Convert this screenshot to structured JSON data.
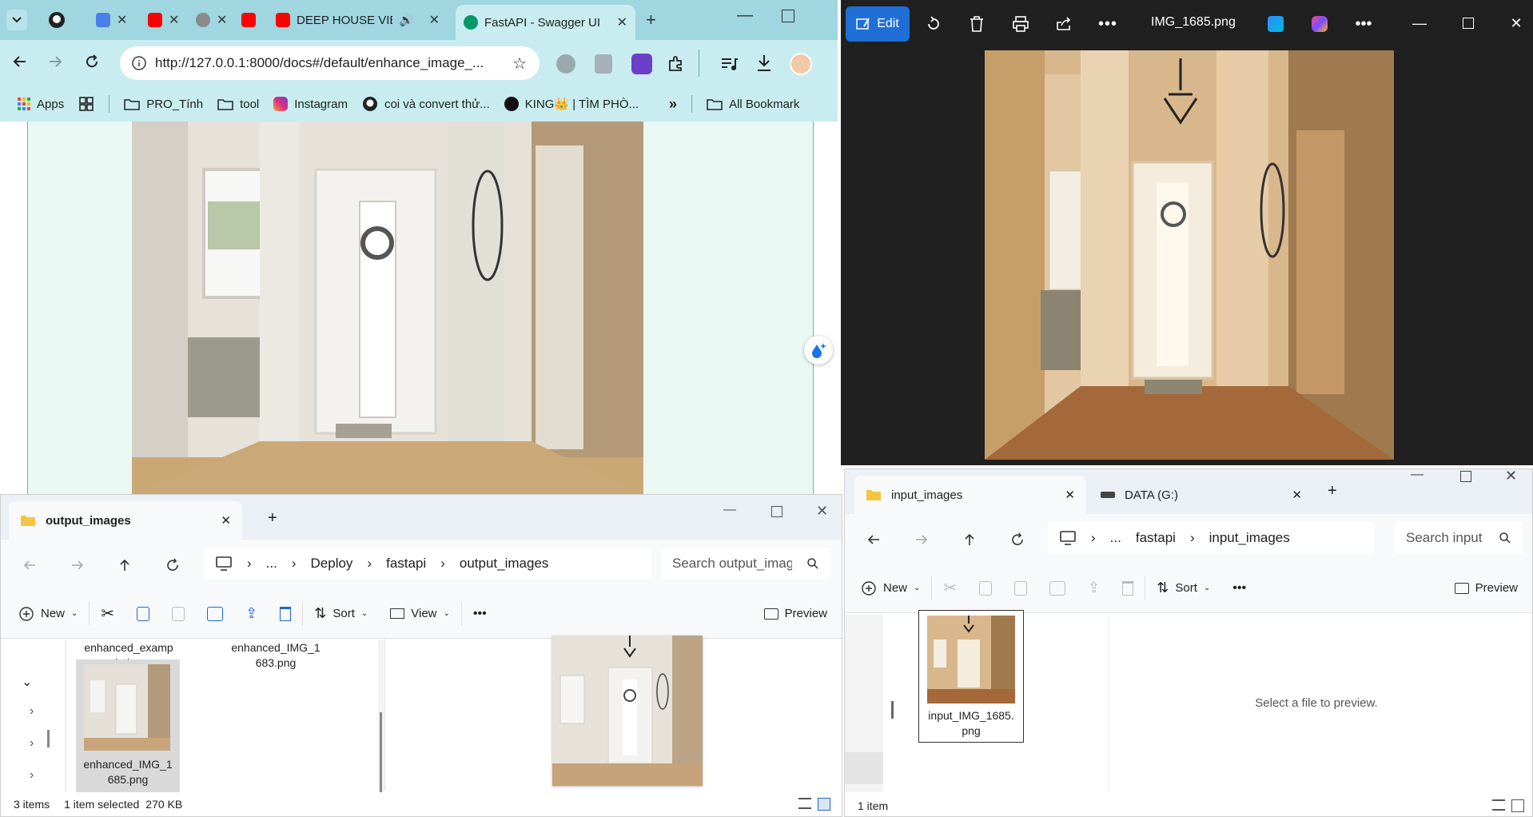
{
  "browser": {
    "tabs": [
      {
        "label": ""
      },
      {
        "label": ""
      },
      {
        "label": ""
      },
      {
        "label": ""
      },
      {
        "label": ""
      },
      {
        "label": ""
      },
      {
        "label": "DEEP HOUSE VIET"
      },
      {
        "label": "FastAPI - Swagger UI"
      }
    ],
    "url": "http://127.0.0.1:8000/docs#/default/enhance_image_...",
    "bookmarks": [
      {
        "label": "Apps"
      },
      {
        "label": "PRO_Tính"
      },
      {
        "label": "tool"
      },
      {
        "label": "Instagram"
      },
      {
        "label": "coi và convert thử..."
      },
      {
        "label": "KING👑 | TÌM PHÒ..."
      },
      {
        "label": "All Bookmark"
      }
    ],
    "colors": {
      "tabstrip": "#9fd6e0",
      "toolbar": "#c8ecf0",
      "swagger_green": "#49cc90"
    }
  },
  "photos": {
    "edit_label": "Edit",
    "title": "IMG_1685.png",
    "toolbar_icons": [
      "rotate-icon",
      "delete-icon",
      "print-icon",
      "share-icon",
      "more-icon",
      "designer-icon",
      "copilot-icon",
      "more-icon"
    ],
    "accent": "#1f6fd6"
  },
  "explorer_out": {
    "tab_label": "output_images",
    "breadcrumbs": [
      "...",
      "Deploy",
      "fastapi",
      "output_images"
    ],
    "search_placeholder": "Search output_images",
    "commands": {
      "new": "New",
      "sort": "Sort",
      "view": "View",
      "preview": "Preview"
    },
    "files": [
      {
        "name": "enhanced_examp\nle.jpg"
      },
      {
        "name": "enhanced_IMG_1\n683.png"
      },
      {
        "name": "enhanced_IMG_1\n685.png",
        "selected": true
      }
    ],
    "status": {
      "count": "3 items",
      "selected": "1 item selected",
      "size": "270 KB"
    }
  },
  "explorer_in": {
    "tabs": [
      {
        "label": "input_images"
      },
      {
        "label": "DATA (G:)"
      }
    ],
    "breadcrumbs": [
      "...",
      "fastapi",
      "input_images"
    ],
    "search_placeholder": "Search input",
    "commands": {
      "new": "New",
      "sort": "Sort",
      "preview": "Preview"
    },
    "files": [
      {
        "name": "input_IMG_1685.\npng"
      }
    ],
    "preview_text": "Select a file to preview.",
    "status": {
      "count": "1 item"
    }
  }
}
